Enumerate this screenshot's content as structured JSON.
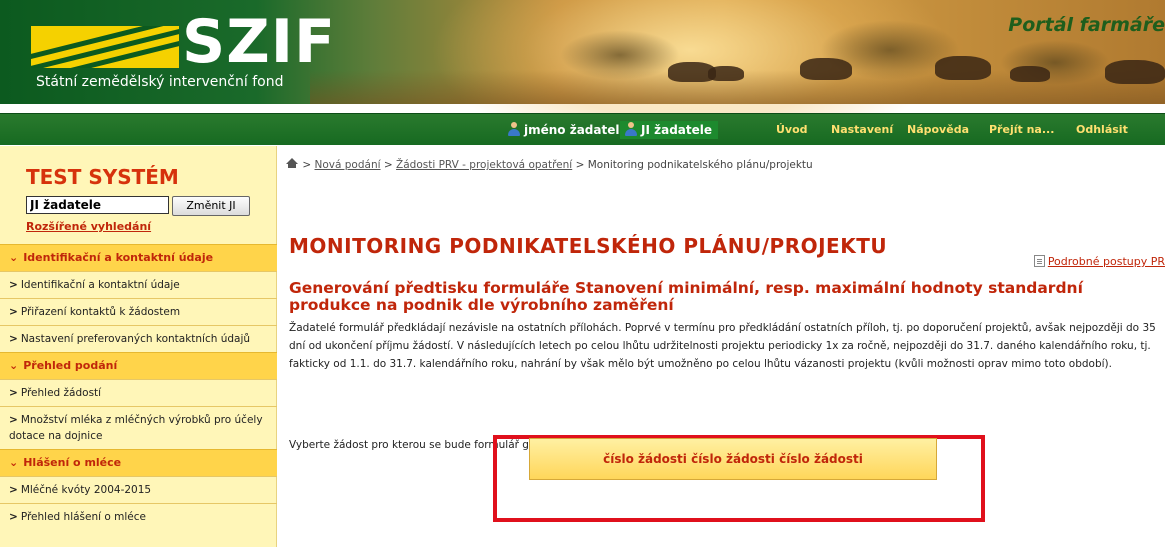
{
  "header": {
    "logo_text": "SZIF",
    "logo_subtitle": "Státní zemědělský intervenční fond",
    "portal_title": "Portál farmáře"
  },
  "menubar": {
    "user_name": "jméno žadatele",
    "ji_label": "JI žadatele",
    "items": [
      "Úvod",
      "Nastavení",
      "Nápověda",
      "Přejít na...",
      "Odhlásit"
    ]
  },
  "sidebar": {
    "test_title": "TEST SYSTÉM",
    "ji_value": "JI žadatele",
    "change_button": "Změnit JI",
    "advanced_search": "Rozšířené vyhledání",
    "entries": [
      {
        "type": "section",
        "label": "Identifikační a kontaktní údaje"
      },
      {
        "type": "item",
        "label": "Identifikační a kontaktní údaje"
      },
      {
        "type": "item",
        "label": "Přiřazení kontaktů k žádostem"
      },
      {
        "type": "item",
        "label": "Nastavení preferovaných kontaktních údajů"
      },
      {
        "type": "section",
        "label": "Přehled podání"
      },
      {
        "type": "item",
        "label": "Přehled žádostí"
      },
      {
        "type": "item",
        "label": "Množství mléka z mléčných výrobků pro účely dotace na dojnice"
      },
      {
        "type": "section",
        "label": "Hlášení o mléce"
      },
      {
        "type": "item",
        "label": "Mléčné kvóty 2004-2015"
      },
      {
        "type": "item",
        "label": "Přehled hlášení o mléce"
      }
    ]
  },
  "main": {
    "breadcrumb": {
      "sep": ">",
      "links": [
        "Nová podání",
        "Žádosti PRV - projektová opatření"
      ],
      "current": "Monitoring podnikatelského plánu/projektu"
    },
    "page_title": "MONITORING PODNIKATELSKÉHO PLÁNU/PROJEKTU",
    "procedures_link": "Podrobné postupy PR",
    "subtitle": "Generování předtisku formuláře Stanovení minimální, resp. maximální hodnoty standardní produkce na podnik dle výrobního zaměření",
    "description": "Žadatelé formulář předkládají nezávisle na ostatních přílohách. Poprvé v termínu pro předkládání ostatních příloh, tj. po doporučení projektů, avšak nejpozději do 35 dní od ukončení příjmu žádostí. V následujících letech po celou lhůtu udržitelnosti projektu periodicky 1x za ročně, nejpozději do 31.7. daného kalendářního roku, tj. fakticky od 1.1. do 31.7. kalendářního roku, nahrání by však mělo být umožněno po celou lhůtu vázanosti projektu (kvůli možnosti oprav mimo toto období).",
    "select_label": "Vyberte žádost pro kterou se bude formulář generovat:",
    "generate_button": "číslo žádosti číslo žádosti číslo žádosti"
  },
  "colors": {
    "brand_green": "#176a21",
    "accent_red": "#c0260a",
    "sidebar_bg": "#fff6b8",
    "section_bg": "#ffd44a",
    "highlight_border": "#e0101c"
  }
}
